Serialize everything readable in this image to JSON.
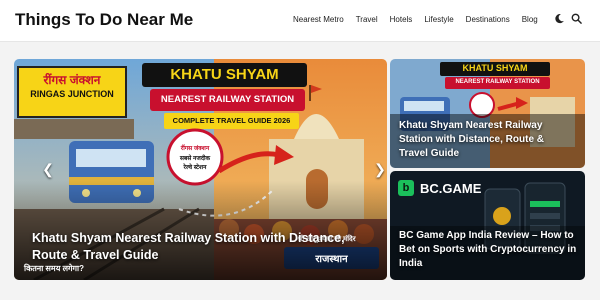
{
  "site": {
    "title": "Things To Do Near Me"
  },
  "nav": {
    "items": [
      "Nearest Metro",
      "Travel",
      "Hotels",
      "Lifestyle",
      "Destinations",
      "Blog"
    ],
    "theme_icon": "moon-icon",
    "search_icon": "search-icon"
  },
  "hero": {
    "image": {
      "badge_title": "KHATU SHYAM",
      "badge_subtitle": "NEAREST RAILWAY STATION",
      "badge_tag": "COMPLETE TRAVEL GUIDE 2026",
      "sign_hindi": "रींगस जंक्शन",
      "sign_english": "RINGAS JUNCTION",
      "circle_line1": "रींगस जंक्शन",
      "circle_line2": "सबसे नजदीक",
      "circle_line3": "रेल्वे स्टेशन",
      "temple_label": "श्री खाटू श्याम जी मंदिर",
      "state_label": "राजस्थान",
      "question": "कितना समय लगेगा?"
    },
    "caption": "Khatu Shyam Nearest Railway Station with Distance, Route & Travel Guide"
  },
  "side_posts": [
    {
      "caption": "Khatu Shyam Nearest Railway Station with Distance, Route & Travel Guide",
      "badge_title": "KHATU SHYAM",
      "badge_subtitle": "NEAREST RAILWAY STATION"
    },
    {
      "caption": "BC Game App India Review – How to Bet on Sports with Cryptocurrency in India",
      "brand": "BC.GAME"
    }
  ],
  "colors": {
    "accent_red": "#c8102e",
    "badge_yellow": "#f7d417",
    "brand_green": "#1bbf5b",
    "dark_bg": "#0f1923"
  }
}
